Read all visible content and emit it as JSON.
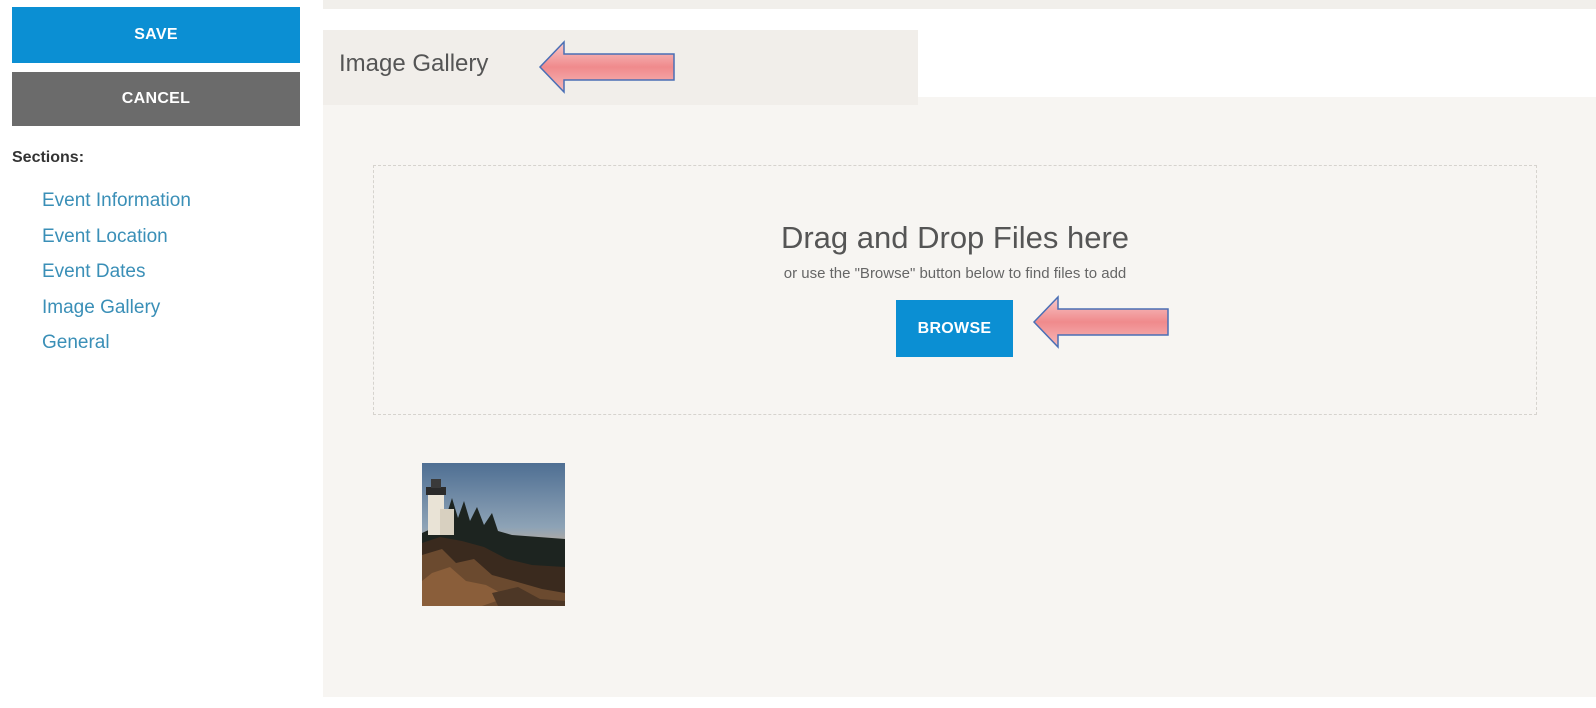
{
  "sidebar": {
    "save_label": "SAVE",
    "cancel_label": "CANCEL",
    "sections_heading": "Sections:",
    "sections": [
      {
        "label": "Event Information"
      },
      {
        "label": "Event Location"
      },
      {
        "label": "Event Dates"
      },
      {
        "label": "Image Gallery"
      },
      {
        "label": "General"
      }
    ]
  },
  "main": {
    "tab_title": "Image Gallery",
    "dropzone": {
      "title": "Drag and Drop Files here",
      "subtitle": "or use the \"Browse\" button below to find files to add",
      "browse_label": "BROWSE"
    },
    "gallery": {
      "images": [
        {
          "icon": "lighthouse-thumbnail"
        }
      ]
    }
  },
  "colors": {
    "primary_blue": "#0b8fd3",
    "cancel_gray": "#6b6b6b",
    "link_blue": "#3a8fb7",
    "panel_bg": "#f7f5f2",
    "tab_bg": "#f1eeea",
    "arrow_fill": "#f08a8c",
    "arrow_stroke": "#4a6fb5"
  },
  "annotations": {
    "arrows": [
      {
        "icon": "annotation-arrow-left",
        "points_to": "tab-title"
      },
      {
        "icon": "annotation-arrow-left",
        "points_to": "browse-button"
      }
    ]
  }
}
